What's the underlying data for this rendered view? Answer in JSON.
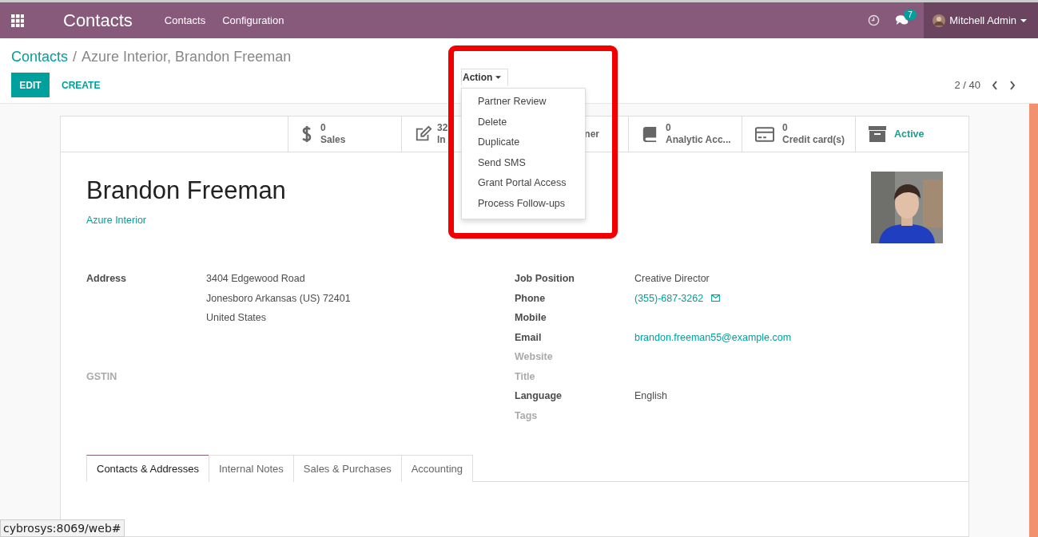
{
  "navbar": {
    "app_name": "Contacts",
    "menus": [
      "Contacts",
      "Configuration"
    ],
    "message_count": "7",
    "user": "Mitchell Admin"
  },
  "breadcrumb": {
    "parent": "Contacts",
    "separator": "/",
    "current": "Azure Interior, Brandon Freeman"
  },
  "buttons": {
    "edit": "EDIT",
    "create": "CREATE"
  },
  "action_menu": {
    "label": "Action",
    "expanded": true,
    "items": [
      "Partner Review",
      "Delete",
      "Duplicate",
      "Send SMS",
      "Grant Portal Access",
      "Process Follow-ups"
    ]
  },
  "pager": "2 / 40",
  "stat_buttons": [
    {
      "kind": "dollar",
      "value": "0",
      "label": "Sales"
    },
    {
      "kind": "edit",
      "value": "32",
      "label": "In"
    },
    {
      "kind": "hidden",
      "label": "ner"
    },
    {
      "kind": "book",
      "value": "0",
      "label": "Analytic Acc..."
    },
    {
      "kind": "card",
      "value": "0",
      "label": "Credit card(s)"
    },
    {
      "kind": "archive",
      "label": "Active"
    }
  ],
  "partner": {
    "name": "Brandon Freeman",
    "company": "Azure Interior"
  },
  "left_fields": [
    {
      "label": "Address",
      "empty": false,
      "lines": [
        "3404 Edgewood Road",
        "Jonesboro  Arkansas (US)  72401",
        "United States"
      ]
    },
    {
      "label": "GSTIN",
      "empty": true
    }
  ],
  "right_fields": [
    {
      "label": "Job Position",
      "empty": false,
      "value": "Creative Director",
      "kind": "text"
    },
    {
      "label": "Phone",
      "empty": false,
      "value": "(355)-687-3262",
      "kind": "phone"
    },
    {
      "label": "Mobile",
      "empty": false
    },
    {
      "label": "Email",
      "empty": false,
      "value": "brandon.freeman55@example.com",
      "kind": "link"
    },
    {
      "label": "Website",
      "empty": true
    },
    {
      "label": "Title",
      "empty": true
    },
    {
      "label": "Language",
      "empty": false,
      "value": "English",
      "kind": "text"
    },
    {
      "label": "Tags",
      "empty": true
    }
  ],
  "tabs": [
    {
      "label": "Contacts & Addresses",
      "selected": true
    },
    {
      "label": "Internal Notes",
      "selected": false
    },
    {
      "label": "Sales & Purchases",
      "selected": false
    },
    {
      "label": "Accounting",
      "selected": false
    }
  ],
  "status_url": "cybrosys:8069/web#"
}
